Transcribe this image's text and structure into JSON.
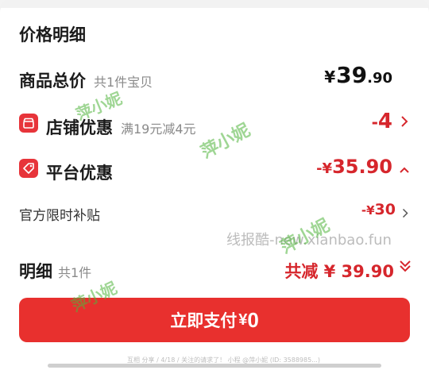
{
  "section_title": "价格明细",
  "goods_total": {
    "label": "商品总价",
    "sub": "共1件宝贝",
    "symbol": "¥",
    "integer": "39",
    "decimal": ".90"
  },
  "store_discount": {
    "label": "店铺优惠",
    "sub": "满19元减4元",
    "prefix": "-",
    "symbol": "¥",
    "amount": "4",
    "icon": "store-icon"
  },
  "platform_discount": {
    "label": "平台优惠",
    "prefix": "-",
    "symbol": "¥",
    "amount": "35.90",
    "icon": "tag-icon"
  },
  "official_subsidy": {
    "label": "官方限时补贴",
    "prefix": "-",
    "symbol": "¥",
    "amount": "30"
  },
  "detail": {
    "label": "明细",
    "sub": "共1件",
    "total_reduce": "共减 ¥ 39.90"
  },
  "pay_button": {
    "label": "立即支付",
    "symbol": "¥",
    "amount": "0"
  },
  "watermarks": {
    "logo_text": "萍小妮",
    "site_text": "线报酷-new.xianbao.fun",
    "footer_text": "互相 分享 / 4/18 / 关注的请求了！ 小程 @萍小妮 (ID: 3588985...)"
  },
  "colors": {
    "accent_red": "#d6262c",
    "button_red": "#e8302e"
  }
}
